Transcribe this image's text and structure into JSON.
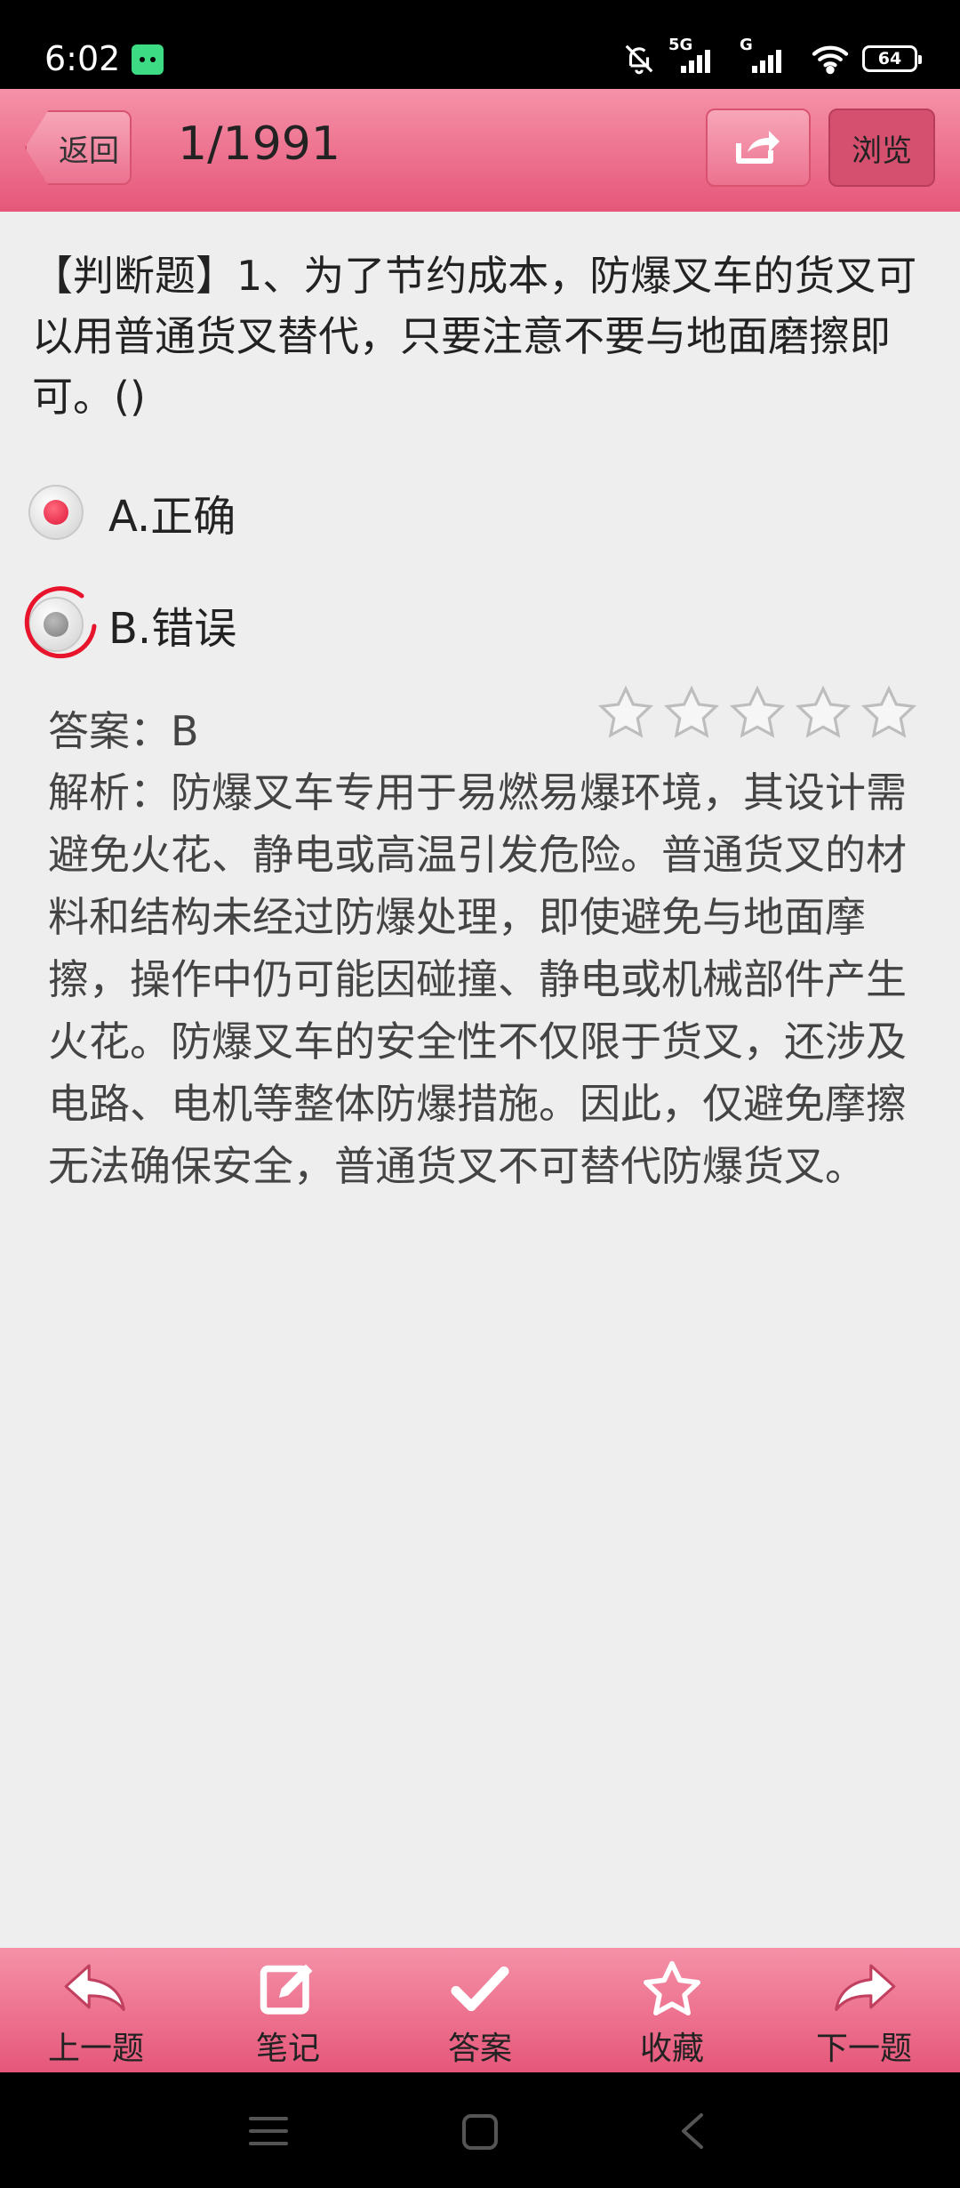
{
  "status_bar": {
    "time": "6:02",
    "signal_1_label": "5G",
    "signal_2_label": "G",
    "battery": "64"
  },
  "header": {
    "back_label": "返回",
    "counter": "1/1991",
    "browse_label": "浏览"
  },
  "question": {
    "text": "【判断题】1、为了节约成本，防爆叉车的货叉可以用普通货叉替代，只要注意不要与地面磨擦即可。()",
    "options": [
      {
        "label": "A.正确",
        "selected": true
      },
      {
        "label": "B.错误",
        "selected": false
      }
    ]
  },
  "answer": {
    "label": "答案：B",
    "rating_stars": 0,
    "rating_max": 5
  },
  "explanation": "解析：防爆叉车专用于易燃易爆环境，其设计需避免火花、静电或高温引发危险。普通货叉的材料和结构未经过防爆处理，即使避免与地面摩擦，操作中仍可能因碰撞、静电或机械部件产生火花。防爆叉车的安全性不仅限于货叉，还涉及电路、电机等整体防爆措施。因此，仅避免摩擦无法确保安全，普通货叉不可替代防爆货叉。",
  "toolbar": {
    "prev_label": "上一题",
    "note_label": "笔记",
    "answer_label": "答案",
    "favorite_label": "收藏",
    "next_label": "下一题"
  },
  "colors": {
    "header_top": "#f591a8",
    "header_bottom": "#e6577a",
    "selected_radio": "#e0163a",
    "background": "#eeeeee"
  }
}
